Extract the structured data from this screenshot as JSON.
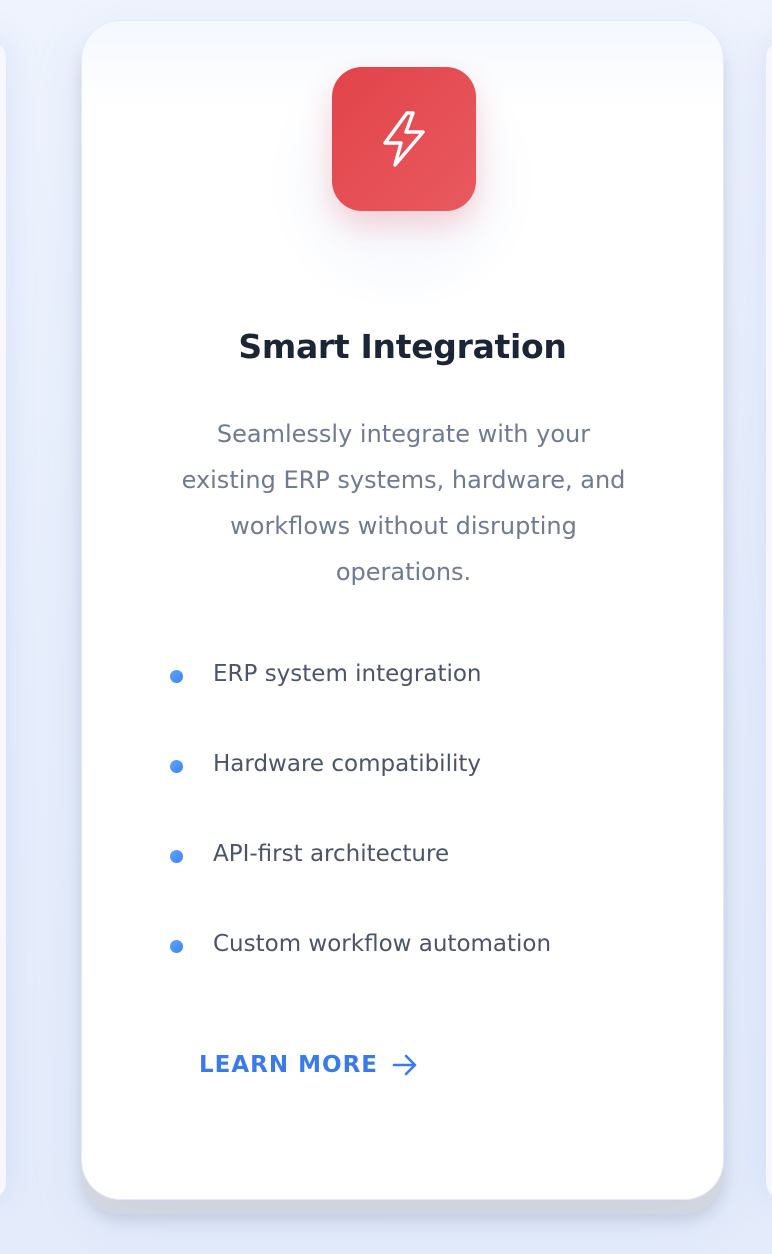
{
  "card": {
    "icon": "lightning-bolt-icon",
    "icon_color": "#e2434a",
    "title": "Smart Integration",
    "description": "Seamlessly integrate with your existing ERP systems, hardware, and workflows without disrupting operations.",
    "features": [
      "ERP system integration",
      "Hardware compatibility",
      "API-first architecture",
      "Custom workflow automation"
    ],
    "bullet_color": "#3b82f6",
    "cta": {
      "label": "LEARN MORE",
      "icon": "arrow-right-icon",
      "color": "#3b7be8"
    }
  }
}
